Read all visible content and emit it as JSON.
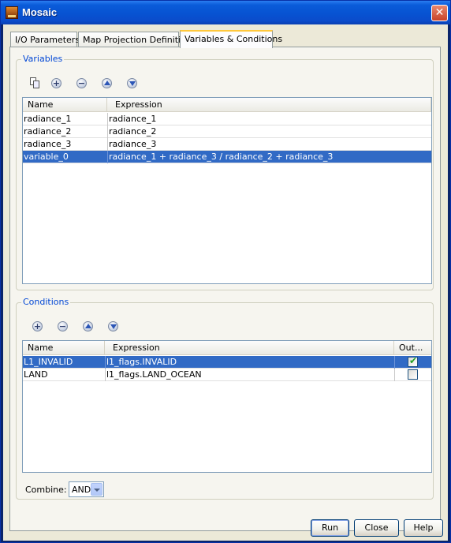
{
  "window": {
    "title": "Mosaic",
    "close_glyph": "✕"
  },
  "tabs": [
    {
      "label": "I/O Parameters"
    },
    {
      "label": "Map Projection Definition"
    },
    {
      "label": "Variables & Conditions"
    }
  ],
  "active_tab": 2,
  "variables": {
    "group_label": "Variables",
    "toolbar_icons": [
      "copy-icon",
      "add-icon",
      "remove-icon",
      "move-up-icon",
      "move-down-icon"
    ],
    "columns": [
      "Name",
      "Expression"
    ],
    "rows": [
      {
        "name": "radiance_1",
        "expression": "radiance_1",
        "selected": false
      },
      {
        "name": "radiance_2",
        "expression": "radiance_2",
        "selected": false
      },
      {
        "name": "radiance_3",
        "expression": "radiance_3",
        "selected": false
      },
      {
        "name": "variable_0",
        "expression": "radiance_1 + radiance_3 / radiance_2 + radiance_3",
        "selected": true
      }
    ]
  },
  "conditions": {
    "group_label": "Conditions",
    "toolbar_icons": [
      "add-icon",
      "remove-icon",
      "move-up-icon",
      "move-down-icon"
    ],
    "columns": [
      "Name",
      "Expression",
      "Out..."
    ],
    "rows": [
      {
        "name": "L1_INVALID",
        "expression": "l1_flags.INVALID",
        "output": true,
        "selected": true
      },
      {
        "name": "LAND",
        "expression": "l1_flags.LAND_OCEAN",
        "output": false,
        "selected": false
      }
    ]
  },
  "combine": {
    "label": "Combine:",
    "value": "AND"
  },
  "buttons": {
    "run": "Run",
    "close": "Close",
    "help": "Help"
  },
  "colors": {
    "selection": "#316ac5",
    "group_label": "#0046d5",
    "check": "#21a121"
  }
}
